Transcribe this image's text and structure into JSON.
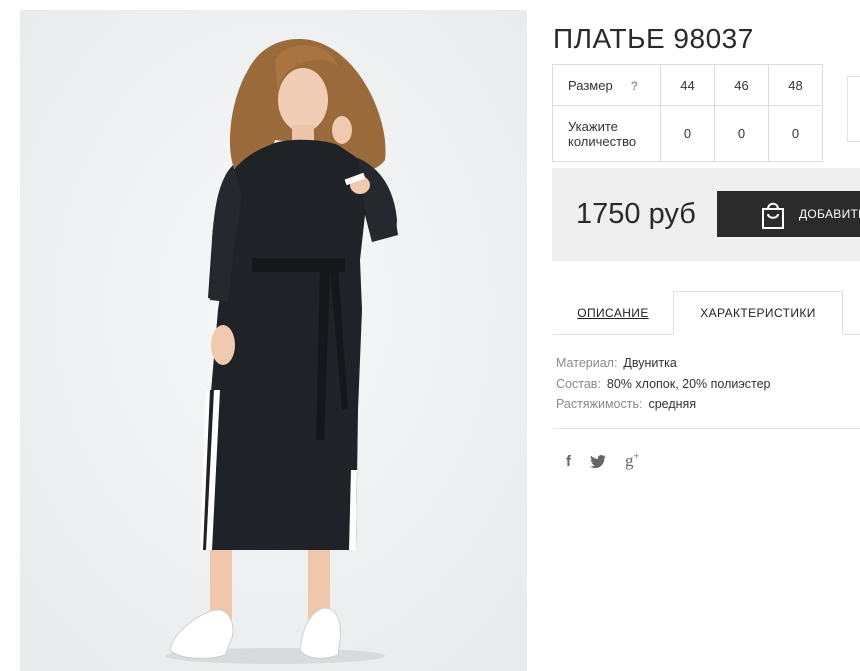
{
  "product": {
    "title": "ПЛАТЬЕ 98037",
    "image_alt": "model-in-black-dress"
  },
  "size_table": {
    "size_label": "Размер",
    "help": "?",
    "sizes": [
      "44",
      "46",
      "48"
    ],
    "qty_label": "Укажите количество",
    "quantities": [
      "0",
      "0",
      "0"
    ]
  },
  "purchase": {
    "price": "1750 руб",
    "add_button": "ДОБАВИТЬ"
  },
  "tabs": {
    "description": "ОПИСАНИЕ",
    "characteristics": "ХАРАКТЕРИСТИКИ",
    "active": "characteristics"
  },
  "specs": [
    {
      "key": "Материал:",
      "value": "Двунитка"
    },
    {
      "key": "Состав:",
      "value": "80% хлопок, 20% полиэстер"
    },
    {
      "key": "Растяжимость:",
      "value": "средняя"
    }
  ],
  "social": {
    "facebook": "f",
    "twitter": "twitter-icon",
    "googleplus": "g"
  },
  "colors": {
    "button_bg": "#2b2b2b",
    "price_bg": "#efefef",
    "photo_bg": "#eceef0"
  }
}
